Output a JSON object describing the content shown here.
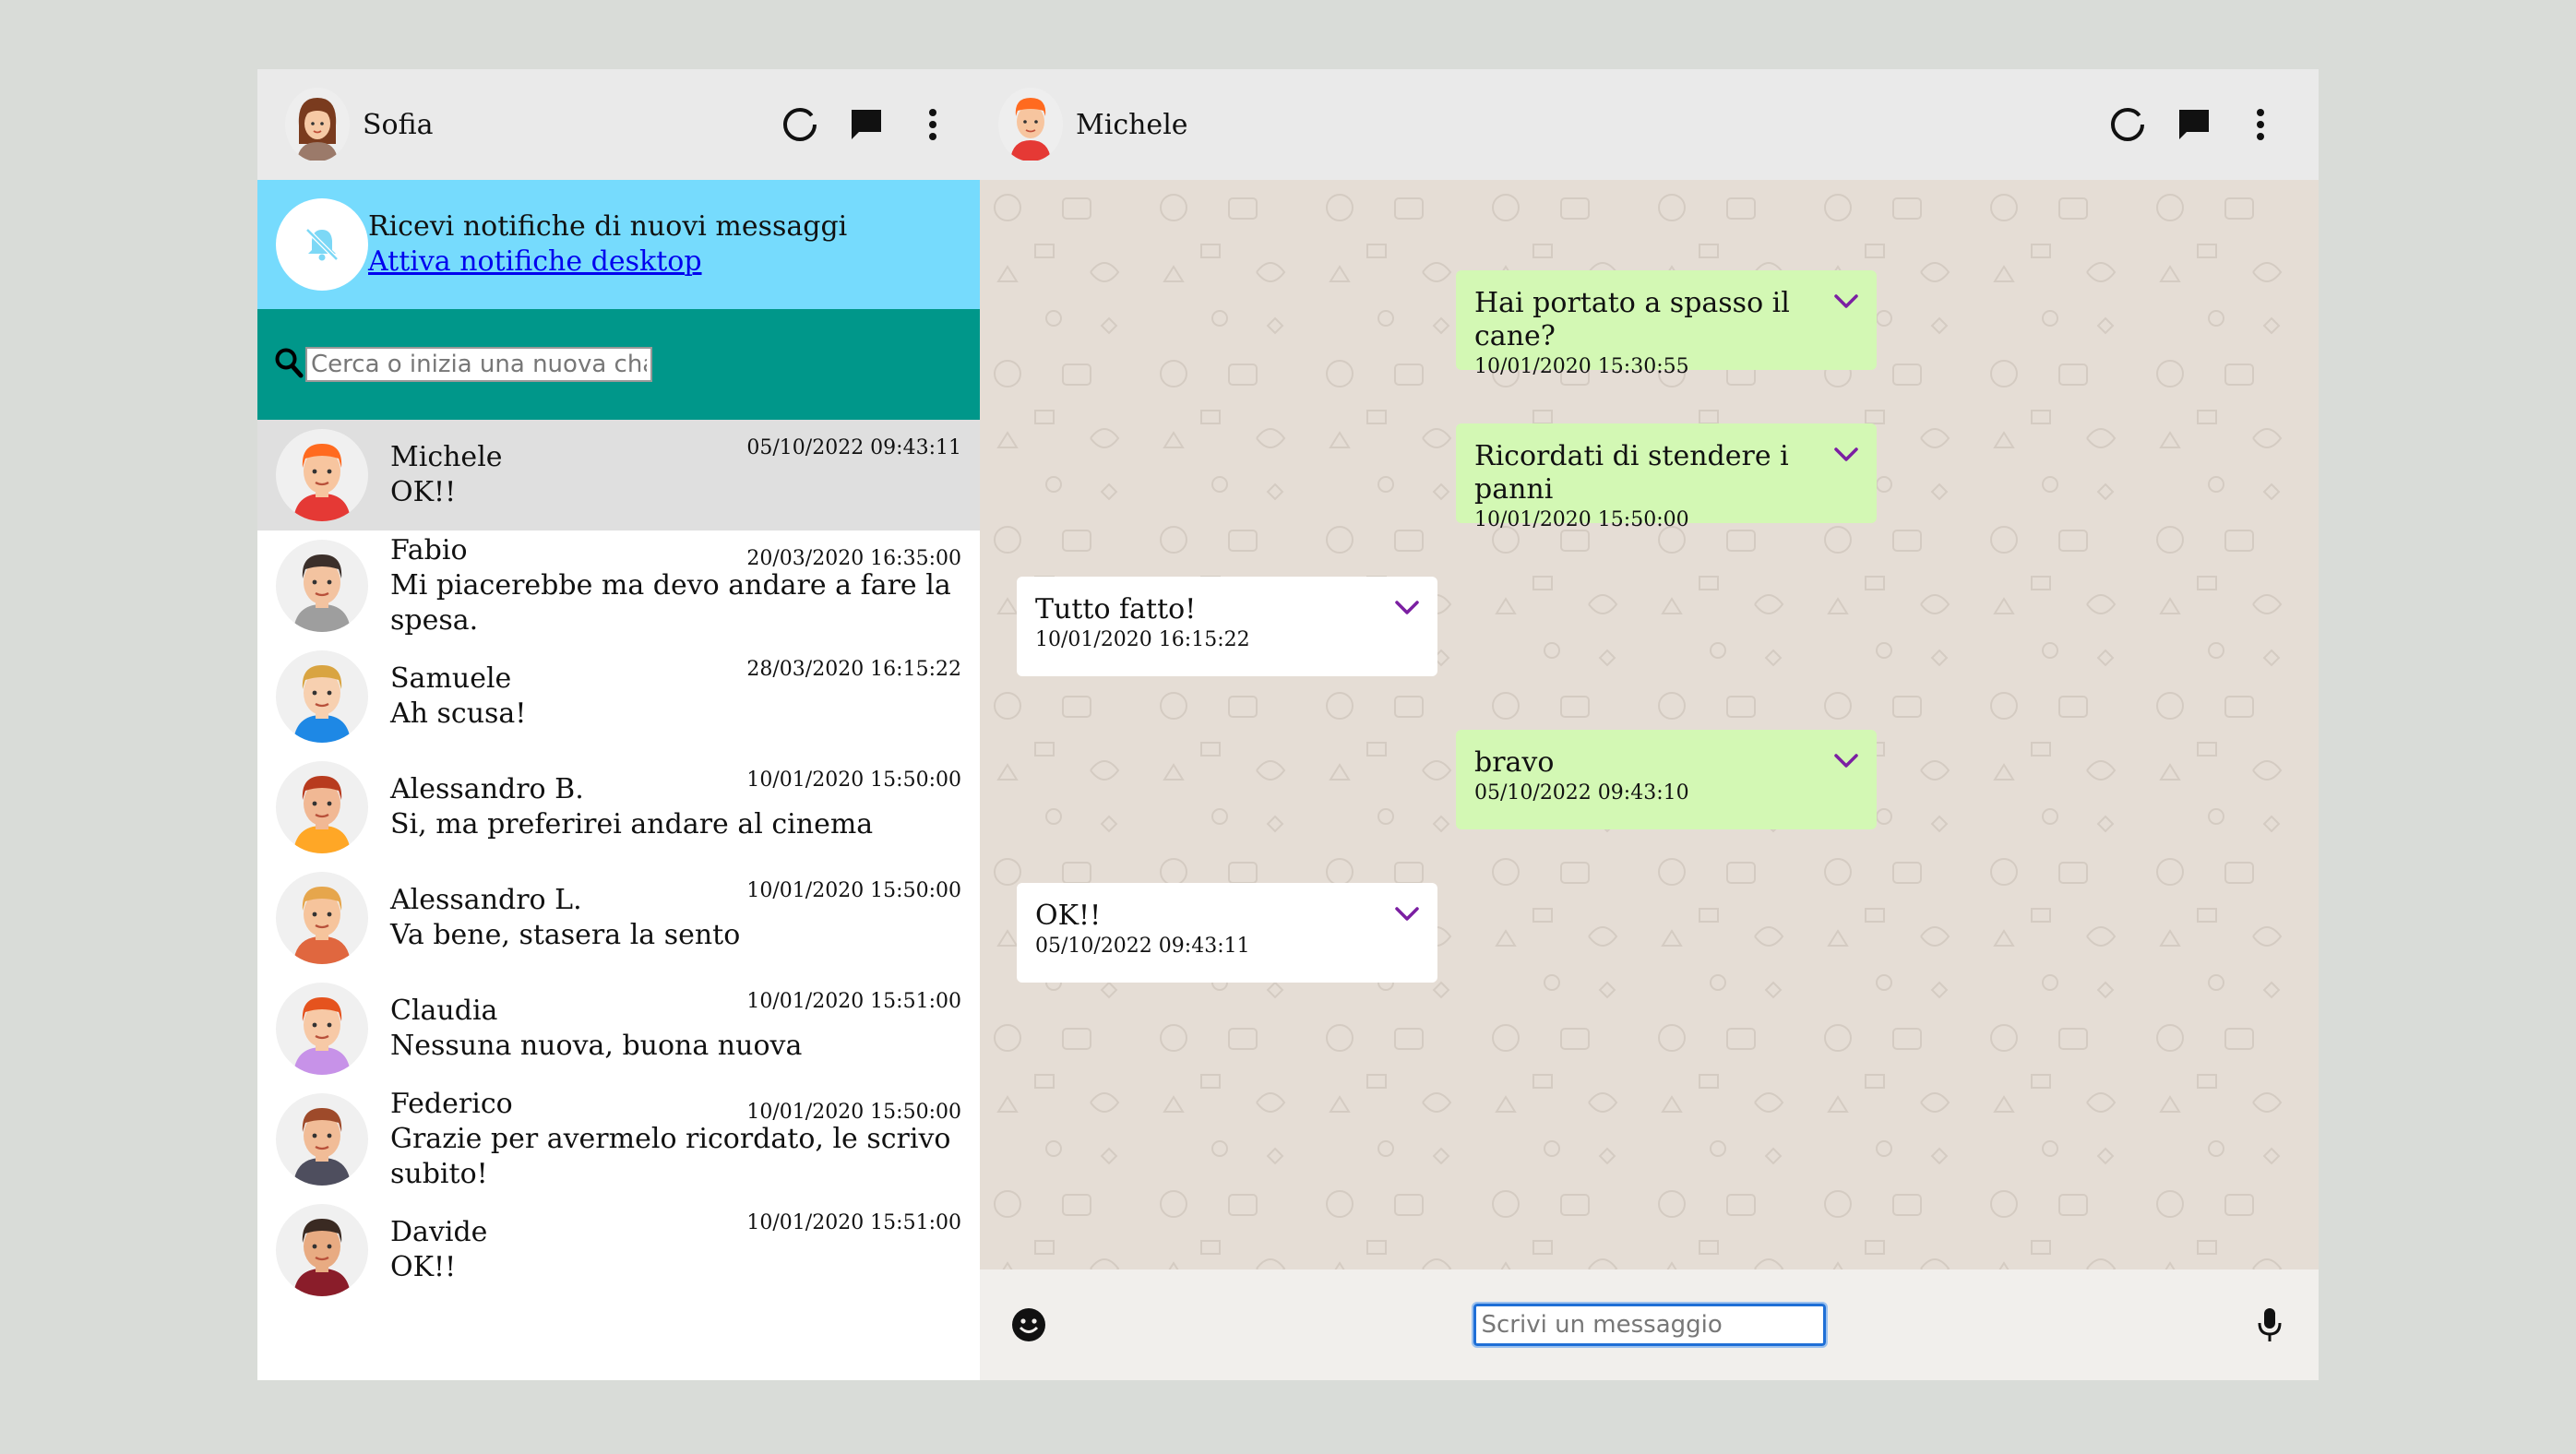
{
  "user": {
    "name": "Sofia"
  },
  "notification": {
    "title": "Ricevi notifiche di nuovi messaggi",
    "link": "Attiva notifiche desktop"
  },
  "search": {
    "placeholder": "Cerca o inizia una nuova chat"
  },
  "contacts": [
    {
      "name": "Michele",
      "last": "OK!!",
      "time": "05/10/2022 09:43:11",
      "hair": "#ff6a1f",
      "shirt": "#e53935",
      "skin": "#f7c59f",
      "active": true
    },
    {
      "name": "Fabio",
      "last": "Mi piacerebbe ma devo andare a fare la spesa.",
      "time": "20/03/2020 16:35:00",
      "hair": "#3b2f2a",
      "shirt": "#9e9e9e",
      "skin": "#f3c3a0"
    },
    {
      "name": "Samuele",
      "last": "Ah scusa!",
      "time": "28/03/2020 16:15:22",
      "hair": "#d9a441",
      "shirt": "#1e88e5",
      "skin": "#f7d0b0"
    },
    {
      "name": "Alessandro B.",
      "last": "Si, ma preferirei andare al cinema",
      "time": "10/01/2020 15:50:00",
      "hair": "#b83b1e",
      "shirt": "#ffa726",
      "skin": "#f1b894"
    },
    {
      "name": "Alessandro L.",
      "last": "Va bene, stasera la sento",
      "time": "10/01/2020 15:50:00",
      "hair": "#e6a64c",
      "shirt": "#e0673f",
      "skin": "#f6c49c"
    },
    {
      "name": "Claudia",
      "last": "Nessuna nuova, buona nuova",
      "time": "10/01/2020 15:51:00",
      "hair": "#e5531e",
      "shirt": "#c792e8",
      "skin": "#f7c9a6"
    },
    {
      "name": "Federico",
      "last": "Grazie per avermelo ricordato, le scrivo subito!",
      "time": "10/01/2020 15:50:00",
      "hair": "#9e4a2a",
      "shirt": "#4e4e5e",
      "skin": "#f1bc97"
    },
    {
      "name": "Davide",
      "last": "OK!!",
      "time": "10/01/2020 15:51:00",
      "hair": "#3a2a22",
      "shirt": "#8a1d2a",
      "skin": "#e8ab82"
    }
  ],
  "chat": {
    "contact_name": "Michele",
    "messages": [
      {
        "text": "Hai portato a spasso il cane?",
        "time": "10/01/2020 15:30:55",
        "side": "sent"
      },
      {
        "text": "Ricordati di stendere i panni",
        "time": "10/01/2020 15:50:00",
        "side": "sent"
      },
      {
        "text": "Tutto fatto!",
        "time": "10/01/2020 16:15:22",
        "side": "recv"
      },
      {
        "text": "bravo",
        "time": "05/10/2022 09:43:10",
        "side": "sent"
      },
      {
        "text": "OK!!",
        "time": "05/10/2022 09:43:11",
        "side": "recv"
      }
    ]
  },
  "compose": {
    "placeholder": "Scrivi un messaggio"
  },
  "colors": {
    "accent": "#00978a",
    "notify_bg": "#76dbfd",
    "sent_bubble": "#d3f8b4",
    "chevron": "#7b1fa2"
  },
  "icons": [
    "status-icon",
    "chat-icon",
    "menu-dots-icon",
    "bell-off-icon",
    "search-icon",
    "chevron-down-icon",
    "smiley-icon",
    "microphone-icon"
  ]
}
